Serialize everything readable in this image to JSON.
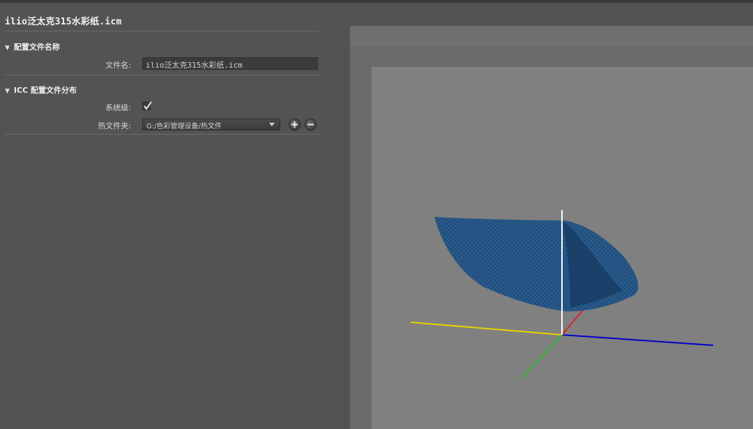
{
  "panel": {
    "title": "ilio泛太克315水彩纸.icm",
    "section_profile_name": {
      "header": "配置文件名称",
      "filename_label": "文件名:",
      "filename_value": "ilio泛太克315水彩纸.icm"
    },
    "section_distribution": {
      "header": "ICC 配置文件分布",
      "system_level_label": "系统级:",
      "system_level_checked": true,
      "hot_folder_label": "热文件夹:",
      "hot_folder_value": "G:/色彩管理设备/热文件",
      "add_icon": "plus-icon",
      "remove_icon": "minus-icon"
    }
  },
  "viewer": {
    "axis_colors": {
      "x": "#0000cc",
      "y": "#e6d200",
      "z": "#ffffff",
      "red": "#dd2222",
      "green": "#22bb22"
    },
    "gamut_color": "#1f4f7f",
    "background": "#808080"
  }
}
